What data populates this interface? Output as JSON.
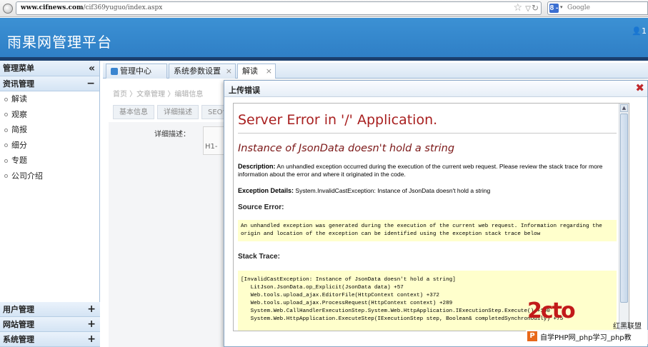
{
  "browser": {
    "url": "www.cifnews.com/cif369yuguo/index.aspx",
    "url_host": "www.cifnews.com",
    "url_path": "/cif369yuguo/index.aspx",
    "search_engine": "Google",
    "search_prefix": "8 -"
  },
  "header": {
    "title": "雨果网管理平台",
    "user": "1"
  },
  "sidebar": {
    "heading": "管理菜单",
    "collapse_symbol": "«",
    "sections": [
      {
        "label": "资讯管理",
        "toggle": "−"
      }
    ],
    "items": [
      "解读",
      "观察",
      "简报",
      "细分",
      "专题",
      "公司介绍"
    ],
    "bottom_sections": [
      {
        "label": "用户管理",
        "toggle": "+"
      },
      {
        "label": "网站管理",
        "toggle": "+"
      },
      {
        "label": "系统管理",
        "toggle": "+"
      }
    ]
  },
  "tabs": [
    {
      "label": "管理中心",
      "closable": false
    },
    {
      "label": "系统参数设置",
      "closable": true,
      "close": "×"
    },
    {
      "label": "解读",
      "closable": true,
      "close": "×"
    }
  ],
  "background_page": {
    "breadcrumb": "首页 〉文章管理 〉编辑信息",
    "subtabs": [
      "基本信息",
      "详细描述",
      "SEO设"
    ],
    "field_label": "详细描述：",
    "editor_tag": "H1-"
  },
  "dialog": {
    "title": "上传错误",
    "close": "✖",
    "error": {
      "heading": "Server Error in '/' Application.",
      "subheading": "Instance of JsonData doesn't hold a string",
      "description_label": "Description:",
      "description_text": "An unhandled exception occurred during the execution of the current web request. Please review the stack trace for more information about the error and where it originated in the code.",
      "exception_label": "Exception Details:",
      "exception_text": "System.InvalidCastException: Instance of JsonData doesn't hold a string",
      "source_label": "Source Error:",
      "source_text": "An unhandled exception was generated during the execution of the current web request. Information regarding the\norigin and location of the exception can be identified using the exception stack trace below",
      "stack_label": "Stack Trace:",
      "stack_text": "[InvalidCastException: Instance of JsonData doesn't hold a string]\n   LitJson.JsonData.op_Explicit(JsonData data) +57\n   Web.tools.upload_ajax.EditorFile(HttpContext context) +372\n   Web.tools.upload_ajax.ProcessRequest(HttpContext context) +289\n   System.Web.CallHandlerExecutionStep.System.Web.HttpApplication.IExecutionStep.Execute() +100\n   System.Web.HttpApplication.ExecuteStep(IExecutionStep step, Boolean& completedSynchronously) +75"
    }
  },
  "watermark": {
    "logo": "2cto",
    "tag1": "红黑联盟",
    "tag2": "自学PHP网_php学习_php教",
    "p": "P"
  }
}
